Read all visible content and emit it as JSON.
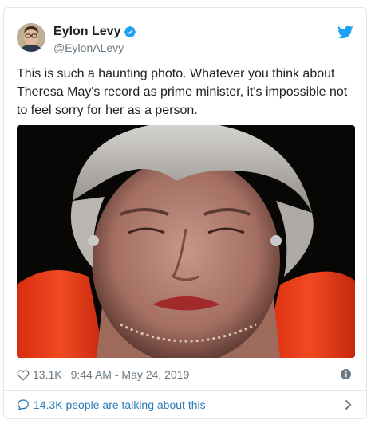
{
  "tweet": {
    "display_name": "Eylon Levy",
    "handle": "@EylonALevy",
    "text": "This is such a haunting photo. Whatever you think about Theresa May's record as prime minister, it's impossible not to feel sorry for her as a person.",
    "like_count": "13.1K",
    "timestamp": "9:44 AM - May 24, 2019",
    "talking_text": "14.3K people are talking about this"
  },
  "icons": {
    "verified": "verified-badge-icon",
    "brand": "twitter-bird-icon",
    "like": "heart-icon",
    "info": "info-icon",
    "conversation": "speech-bubble-icon",
    "open": "chevron-right-icon"
  },
  "colors": {
    "accent": "#1da1f2",
    "link": "#2b7bb9",
    "secondary_text": "#697882",
    "border": "#e1e8ed"
  }
}
